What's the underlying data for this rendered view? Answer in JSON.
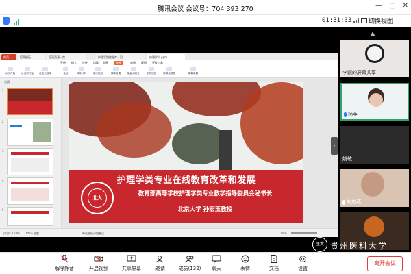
{
  "window": {
    "title": "腾讯会议 会议号：704 393 270",
    "controls": [
      "—",
      "□",
      "✕"
    ]
  },
  "meetingbar": {
    "timer": "01:31:33",
    "switch_view": "切换视图"
  },
  "ppt": {
    "tabs": [
      "首页",
      "稻壳模板",
      "稻壳资源 - 完...",
      "护理学院数据库 - 设...",
      "护理学科.pptx"
    ],
    "menus": [
      "开始",
      "插入",
      "设计",
      "切换",
      "动画",
      "放映",
      "审阅",
      "视图",
      "开发工具"
    ],
    "ribbon": [
      "从头开始",
      "从当前开始",
      "自定义放映",
      "会议",
      "排练计时",
      "演示焦点",
      "放映设置",
      "隐藏幻灯片",
      "手机遥控",
      "演讲者视图",
      "屏幕录制"
    ],
    "left_header": "大纲",
    "thumbs": [
      "1",
      "2",
      "3",
      "4",
      "5"
    ],
    "status": {
      "slide": "幻灯片 1 / 46",
      "theme": "Office 主题",
      "notes": "单击此处添加备注",
      "zoom": "89%"
    }
  },
  "slide": {
    "title": "护理学类专业在线教育改革和发展",
    "subtitle": "教育部高等学校护理学类专业教学指导委员会秘书长",
    "speaker": "北京大学 孙宏玉教授",
    "logo_text": "北大"
  },
  "participants": [
    {
      "name": "李颖的屏幕共享",
      "muted": false
    },
    {
      "name": "杨英",
      "muted": false
    },
    {
      "name": "姚敏",
      "muted": false
    },
    {
      "name": "刘态燕",
      "muted": false
    },
    {
      "name": "",
      "muted": false
    }
  ],
  "toolbar": {
    "items": [
      "解除静音",
      "开启视频",
      "共享屏幕",
      "邀请",
      "成员(132)",
      "聊天",
      "表情",
      "文档",
      "设置"
    ],
    "leave": "离开会议"
  },
  "watermark": "贵州医科大学",
  "badge_text": "医大"
}
